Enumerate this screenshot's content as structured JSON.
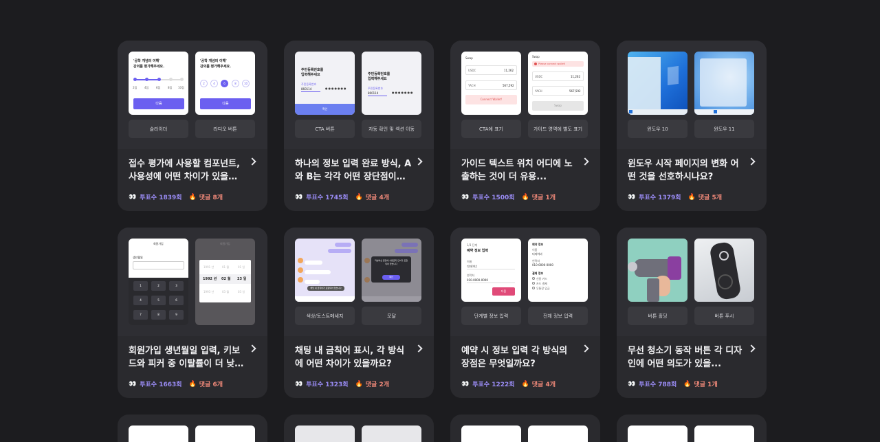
{
  "cards": [
    {
      "title": "접수 평가에 사용할 컴포넌트, 사용성에 어떤 차이가 있을까...",
      "votes": "투표수 1839회",
      "comments": "댓글 8개",
      "options": [
        "슬라이더",
        "라디오 버튼"
      ],
      "thumb_a": {
        "q1": "'공학 개념의 이해'",
        "q2": "강의를 평가해주세요.",
        "btn": "다음",
        "ticks": [
          "2점",
          "4점",
          "6점",
          "8점",
          "10점"
        ]
      },
      "thumb_b": {
        "q1": "'공학 개념의 이해'",
        "q2": "강의를 평가해주세요.",
        "btn": "다음",
        "radios": [
          "2",
          "4",
          "6",
          "8",
          "10"
        ]
      }
    },
    {
      "title": "하나의 정보 입력 완료 방식, A와 B는 각각 어떤 장단점이 있...",
      "votes": "투표수 1745회",
      "comments": "댓글 4개",
      "options": [
        "CTA 버튼",
        "자동 확인 및 섹션 이동"
      ],
      "thumb_a": {
        "h1": "주민등록번호를",
        "h2": "입력해주세요",
        "label": "주민등록번호",
        "value": "860114",
        "btn": "확인"
      },
      "thumb_b": {
        "h1": "주민등록번호를",
        "h2": "입력해주세요",
        "label": "주민등록번호",
        "value": "860114"
      }
    },
    {
      "title": "가이드 텍스트 위치 어디에 노출하는 것이 더 유용...",
      "votes": "투표수 1500회",
      "comments": "댓글 1개",
      "options": [
        "CTA에 표기",
        "가이드 영역에 별도 표기"
      ],
      "thumb_a": {
        "head": "Swap",
        "c1": "USDC",
        "v1": "11,262",
        "c2": "YACH",
        "v2": "567,592",
        "btn": "Connect Wallet!"
      },
      "thumb_b": {
        "head": "Swap",
        "warn": "Please connect wallet!",
        "c1": "USDC",
        "v1": "11,262",
        "c2": "YACH",
        "v2": "567,592",
        "btn": "Swap"
      }
    },
    {
      "title": "윈도우 시작 페이지의 변화 어떤 것을 선호하시나요?",
      "votes": "투표수 1379회",
      "comments": "댓글 5개",
      "options": [
        "윈도우 10",
        "윈도우 11"
      ]
    },
    {
      "title": "회원가입 생년월일 입력, 키보드와 피커 중 이탈률이 더 낮은 ...",
      "votes": "투표수 1663회",
      "comments": "댓글 6개",
      "options": [
        "",
        ""
      ],
      "thumb_a": {
        "head": "회원가입",
        "label": "생년월일",
        "keys": [
          "1",
          "2",
          "3",
          "4",
          "5",
          "6",
          "7",
          "8",
          "9"
        ]
      },
      "thumb_b": {
        "head": "회원가입",
        "rows": [
          [
            "1991 년",
            "01 월",
            "01 일"
          ],
          [
            "1992 년",
            "02 월",
            "23 일"
          ],
          [
            "1993 년",
            "03 월",
            "03 일"
          ]
        ]
      }
    },
    {
      "title": "채팅 내 금칙어 표시, 각 방식에 어떤 차이가 있을까요?",
      "votes": "투표수 1323회",
      "comments": "댓글 2개",
      "options": [
        "색상/토스트메세지",
        "모달"
      ],
      "thumb_b": {
        "modal": "작성하신 문장에 사용금지 단어가 포함되어 있습니다",
        "btn": "확인"
      },
      "thumb_a": {
        "toast": "해당 내 금칙어가 포함되어 있습니다"
      }
    },
    {
      "title": "예약 시 정보 입력 각 방식의 장점은 무엇일까요?",
      "votes": "투표수 1222회",
      "comments": "댓글 4개",
      "options": [
        "단계별 정보 입력",
        "전체 정보 입력"
      ],
      "thumb_a": {
        "step": "1/3 단계",
        "head": "예약 정보 입력",
        "l1": "이름",
        "v1": "디자이너",
        "l2": "연락처",
        "v2": "010-0000-0000",
        "btn": "다음"
      },
      "thumb_b": {
        "head": "예약 정보",
        "l1": "이름",
        "v1": "디자이너",
        "l2": "연락처",
        "v2": "010-0000-0000",
        "l3": "결제 정보",
        "r1": "신용 카드",
        "r2": "카드 결제",
        "r3": "무통장 입금"
      }
    },
    {
      "title": "무선 청소기 동작 버튼 각 디자인에 어떤 의도가 있을...",
      "votes": "투표수 788회",
      "comments": "댓글 1개",
      "options": [
        "버튼 홀딩",
        "버튼 푸시"
      ]
    }
  ],
  "icons": {
    "eyes": "👀",
    "fire": "🔥"
  },
  "colors": {
    "accent": "#6b5ff0",
    "votes": "#9a8cf5",
    "comments": "#f28a7a"
  }
}
